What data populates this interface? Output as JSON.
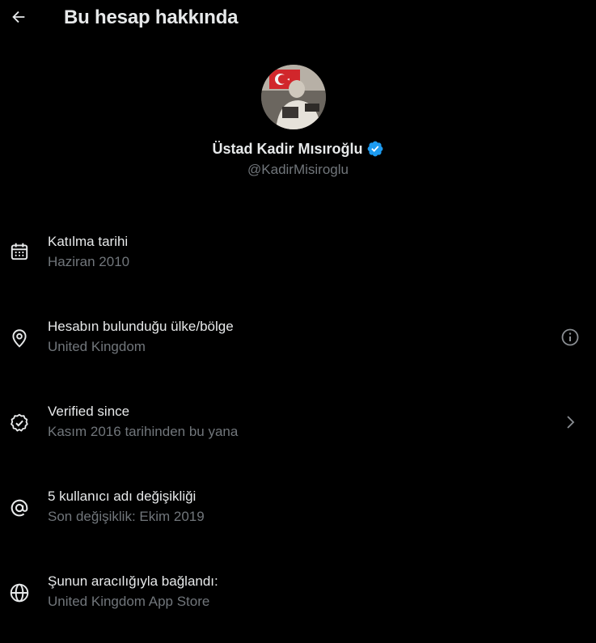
{
  "header": {
    "title": "Bu hesap hakkında",
    "back_icon": "arrow-left-icon"
  },
  "profile": {
    "name": "Üstad Kadir Mısıroğlu",
    "handle": "@KadirMisiroglu",
    "verified_icon": "verified-badge-icon",
    "verified_color": "#1d9bf0"
  },
  "rows": [
    {
      "icon": "calendar-icon",
      "label": "Katılma tarihi",
      "value": "Haziran 2010"
    },
    {
      "icon": "location-pin-icon",
      "label": "Hesabın bulunduğu ülke/bölge",
      "value": "United Kingdom",
      "right_icon": "info-icon"
    },
    {
      "icon": "verified-check-icon",
      "label": "Verified since",
      "value": "Kasım 2016 tarihinden bu yana",
      "right_icon": "chevron-right-icon"
    },
    {
      "icon": "at-sign-icon",
      "label": "5 kullanıcı adı değişikliği",
      "value": "Son değişiklik: Ekim 2019"
    },
    {
      "icon": "globe-icon",
      "label": "Şunun aracılığıyla bağlandı:",
      "value": "United Kingdom App Store"
    }
  ],
  "colors": {
    "background": "#000000",
    "text_primary": "#e7e9ea",
    "text_secondary": "#71767b"
  }
}
